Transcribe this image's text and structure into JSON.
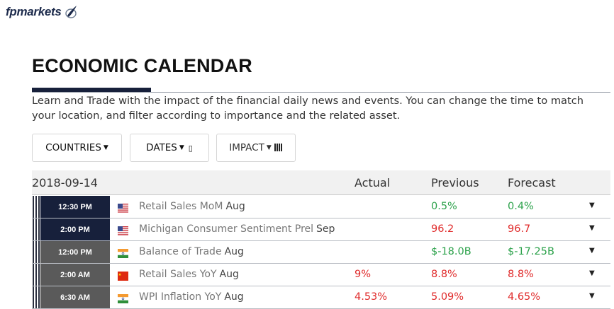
{
  "brand": {
    "name": "fpmarkets"
  },
  "page": {
    "title": "ECONOMIC CALENDAR",
    "intro": "Learn and Trade with the impact of the financial daily news and events. You can change the time to match your location, and filter according to importance and the related asset."
  },
  "filters": {
    "countries": "COUNTRIES",
    "dates": "DATES",
    "impact": "IMPACT"
  },
  "table": {
    "date": "2018-09-14",
    "columns": {
      "actual": "Actual",
      "previous": "Previous",
      "forecast": "Forecast"
    },
    "rows": [
      {
        "time": "12:30 PM",
        "country_icon": "us-flag-icon",
        "event": "Retail Sales MoM",
        "period": "Aug",
        "actual": "",
        "previous": "0.5%",
        "forecast": "0.4%",
        "previous_color": "green",
        "forecast_color": "green",
        "time_bg": "#17203b"
      },
      {
        "time": "2:00 PM",
        "country_icon": "us-flag-icon",
        "event": "Michigan Consumer Sentiment Prel",
        "period": "Sep",
        "actual": "",
        "previous": "96.2",
        "forecast": "96.7",
        "previous_color": "red",
        "forecast_color": "red",
        "time_bg": "#17203b"
      },
      {
        "time": "12:00 PM",
        "country_icon": "india-flag-icon",
        "event": "Balance of Trade",
        "period": "Aug",
        "actual": "",
        "previous": "$-18.0B",
        "forecast": "$-17.25B",
        "previous_color": "green",
        "forecast_color": "green",
        "time_bg": "#5a5a5a"
      },
      {
        "time": "2:00 AM",
        "country_icon": "china-flag-icon",
        "event": "Retail Sales YoY",
        "period": "Aug",
        "actual": "9%",
        "previous": "8.8%",
        "forecast": "8.8%",
        "actual_color": "red",
        "previous_color": "red",
        "forecast_color": "red",
        "time_bg": "#5a5a5a"
      },
      {
        "time": "6:30 AM",
        "country_icon": "india-flag-icon",
        "event": "WPI Inflation YoY",
        "period": "Aug",
        "actual": "4.53%",
        "previous": "5.09%",
        "forecast": "4.65%",
        "actual_color": "red",
        "previous_color": "red",
        "forecast_color": "red",
        "time_bg": "#5a5a5a"
      }
    ]
  },
  "colors": {
    "navy": "#17203b",
    "green": "#2ba14a",
    "red": "#e02a2a",
    "gray_time": "#5a5a5a"
  }
}
